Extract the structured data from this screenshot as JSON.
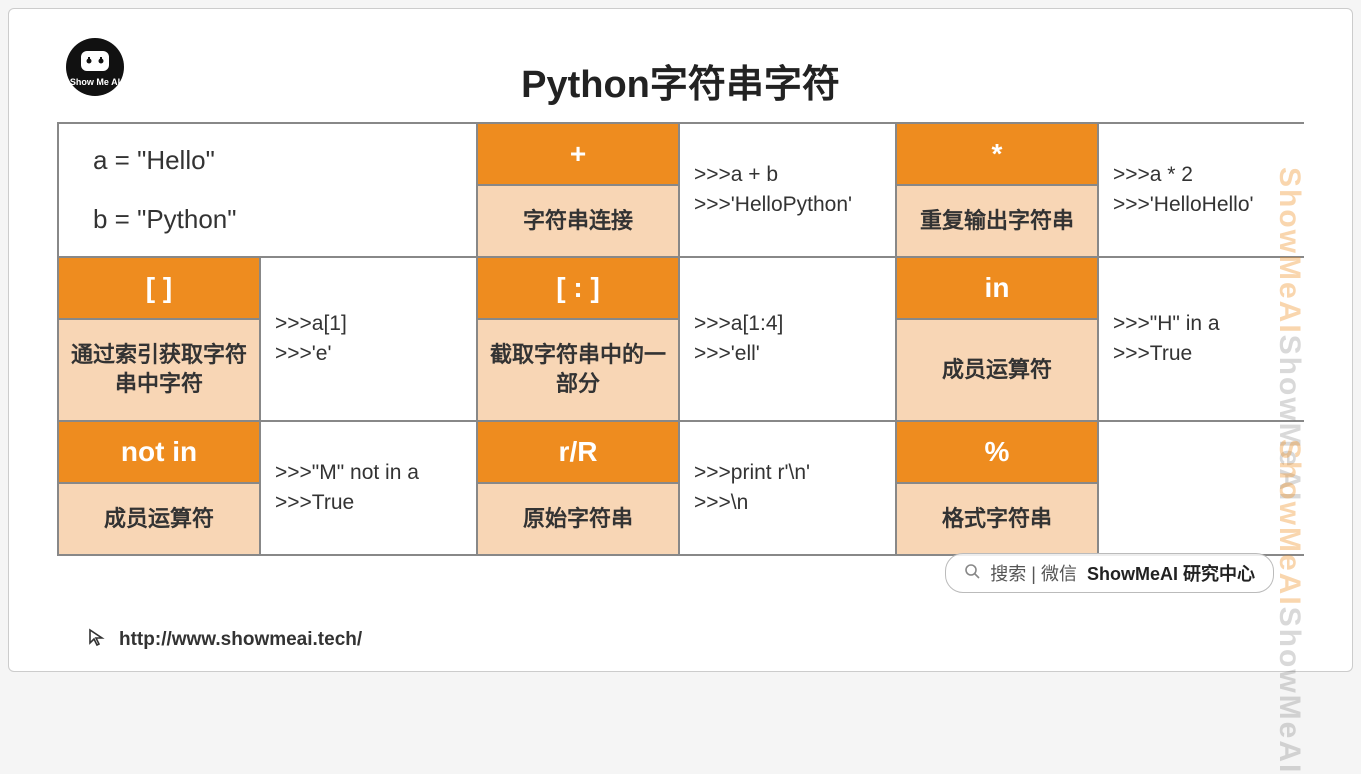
{
  "logo": {
    "top": "Show",
    "mid": "Me",
    "bot": "AI"
  },
  "title": "Python字符串字符",
  "intro": {
    "a": "a = \"Hello\"",
    "b": "b = \"Python\""
  },
  "ops": [
    {
      "symbol": "+",
      "desc": "字符串连接",
      "ex1": ">>>a + b",
      "ex2": ">>>'HelloPython'"
    },
    {
      "symbol": "*",
      "desc": "重复输出字符串",
      "ex1": ">>>a * 2",
      "ex2": ">>>'HelloHello'"
    },
    {
      "symbol": "[ ]",
      "desc": "通过索引获取字符串中字符",
      "ex1": ">>>a[1]",
      "ex2": ">>>'e'"
    },
    {
      "symbol": "[ : ]",
      "desc": "截取字符串中的一部分",
      "ex1": ">>>a[1:4]",
      "ex2": ">>>'ell'"
    },
    {
      "symbol": "in",
      "desc": "成员运算符",
      "ex1": ">>>\"H\" in a",
      "ex2": ">>>True"
    },
    {
      "symbol": "not in",
      "desc": "成员运算符",
      "ex1": ">>>\"M\" not in a",
      "ex2": ">>>True"
    },
    {
      "symbol": "r/R",
      "desc": "原始字符串",
      "ex1": ">>>print r'\\n'",
      "ex2": ">>>\\n"
    },
    {
      "symbol": "%",
      "desc": "格式字符串",
      "ex1": "",
      "ex2": ""
    }
  ],
  "footer": {
    "url": "http://www.showmeai.tech/"
  },
  "watermark": {
    "text": "ShowMeAI"
  },
  "search_overlay": {
    "hint": "搜索 | 微信",
    "brand": "ShowMeAI 研究中心"
  }
}
